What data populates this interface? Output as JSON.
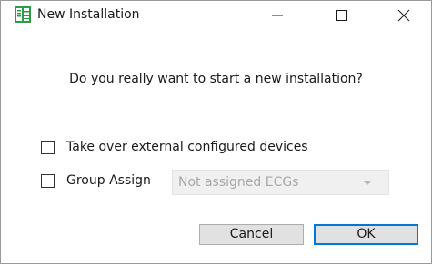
{
  "window": {
    "title": "New Installation",
    "app_icon": "spreadsheet-app-icon",
    "controls": {
      "minimize_icon": "minimize-icon",
      "maximize_icon": "maximize-icon",
      "close_icon": "close-icon"
    }
  },
  "dialog": {
    "question": "Do you really want to start a new installation?",
    "options": [
      {
        "label": "Take over external configured devices",
        "checked": false
      },
      {
        "label": "Group Assign",
        "checked": false
      }
    ],
    "group_select": {
      "value": "Not assigned ECGs",
      "enabled": false
    },
    "buttons": {
      "cancel_label": "Cancel",
      "ok_label": "OK"
    }
  },
  "colors": {
    "app_icon_green": "#2e9b45",
    "default_button_border": "#0078d7",
    "disabled_text": "#a8a8a8"
  }
}
